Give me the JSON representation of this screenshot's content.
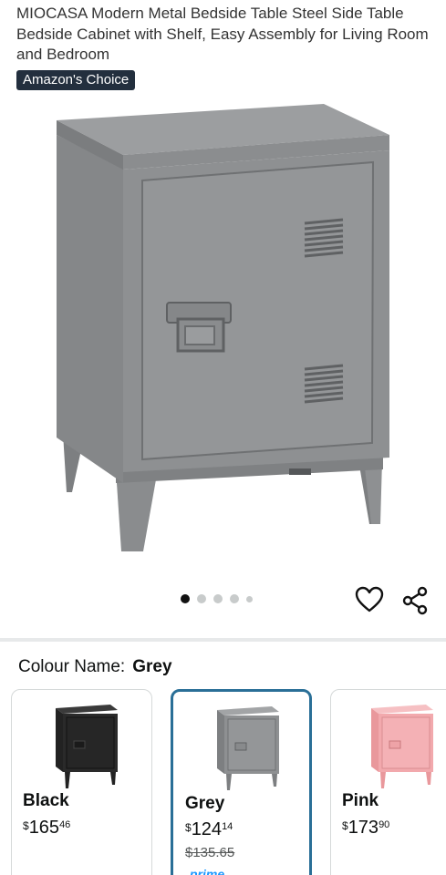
{
  "product": {
    "title": "MIOCASA Modern Metal Bedside Table Steel Side Table Bedside Cabinet with Shelf, Easy Assembly for Living Room and Bedroom",
    "badge": "Amazon's Choice"
  },
  "gallery": {
    "image_count": 5,
    "active_index": 0
  },
  "colour": {
    "label": "Colour Name:",
    "selected": "Grey"
  },
  "options": [
    {
      "name": "Black",
      "currency": "$",
      "price_whole": "165",
      "price_fraction": "46",
      "swatch": "#2a2a2a"
    },
    {
      "name": "Grey",
      "currency": "$",
      "price_whole": "124",
      "price_fraction": "14",
      "was_price": "$135.65",
      "prime": "prime",
      "swatch": "#8e9092",
      "selected": true
    },
    {
      "name": "Pink",
      "currency": "$",
      "price_whole": "173",
      "price_fraction": "90",
      "swatch": "#f2a9ad"
    }
  ],
  "colors": {
    "badge_bg": "#232f3e",
    "selected_border": "#2a6f97",
    "cabinet_grey": "#8e9092"
  },
  "icons": [
    "heart-icon",
    "share-icon"
  ]
}
